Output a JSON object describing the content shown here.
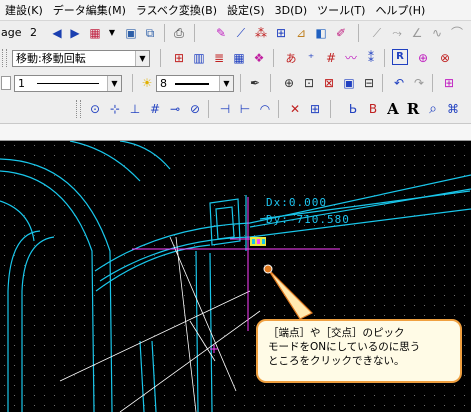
{
  "menubar": {
    "items": [
      "建設(K)",
      "データ編集(M)",
      "ラスベク変換(B)",
      "設定(S)",
      "3D(D)",
      "ツール(T)",
      "ヘルプ(H)"
    ]
  },
  "toolbar1": {
    "page_label": "age",
    "page_number": "2"
  },
  "toolbar2": {
    "command_combo": "移動:移動回転"
  },
  "toolbar3": {
    "line_width_value": "1",
    "size_value": "8"
  },
  "canvas": {
    "dx_readout": "Dx:0.000",
    "dy_readout": "Dy:-710.580",
    "colors": {
      "background": "#000000",
      "drawing_lines": "#19c6ea",
      "guide_lines": "#ff40ff",
      "construction_lines": "#ffffff",
      "snap_marker": "#e8e840",
      "grid_dots": "#6e6e6e"
    }
  },
  "callout": {
    "lines": [
      "［端点］や［交点］のピック",
      "モードをONにしているのに思う",
      "ところをクリックできない。"
    ],
    "border_color": "#f0a040",
    "pointer_color": "#e07a20"
  }
}
